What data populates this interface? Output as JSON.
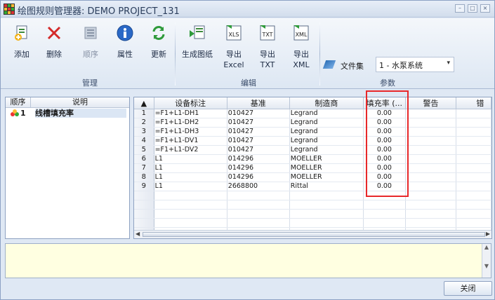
{
  "window": {
    "title": "绘图规则管理器: DEMO PROJECT_131"
  },
  "ribbon": {
    "manage": {
      "label": "管理",
      "add": "添加",
      "delete": "删除",
      "order": "顺序",
      "properties": "属性",
      "update": "更新"
    },
    "edit": {
      "label": "编辑",
      "generate": "生成图纸",
      "export_excel_1": "导出",
      "export_excel_2": "Excel",
      "export_txt_1": "导出",
      "export_txt_2": "TXT",
      "export_xml_1": "导出",
      "export_xml_2": "XML",
      "xls_tag": "XLS",
      "txt_tag": "TXT",
      "xml_tag": "XML"
    },
    "params": {
      "label": "参数",
      "fileset_label": "文件集",
      "fileset_value": "1 - 水泵系统"
    }
  },
  "left_panel": {
    "headers": {
      "order": "顺序",
      "description": "说明"
    },
    "row": {
      "number": "1",
      "description": "线槽填充率"
    }
  },
  "grid": {
    "headers": {
      "device": "设备标注",
      "basis": "基准",
      "manufacturer": "制造商",
      "fill_rate": "填充率 (...",
      "warning": "警告",
      "error": "错"
    },
    "rows": [
      {
        "n": "1",
        "device": "=F1+L1-DH1",
        "basis": "010427",
        "manufacturer": "Legrand",
        "fill": "0.00"
      },
      {
        "n": "2",
        "device": "=F1+L1-DH2",
        "basis": "010427",
        "manufacturer": "Legrand",
        "fill": "0.00"
      },
      {
        "n": "3",
        "device": "=F1+L1-DH3",
        "basis": "010427",
        "manufacturer": "Legrand",
        "fill": "0.00"
      },
      {
        "n": "4",
        "device": "=F1+L1-DV1",
        "basis": "010427",
        "manufacturer": "Legrand",
        "fill": "0.00"
      },
      {
        "n": "5",
        "device": "=F1+L1-DV2",
        "basis": "010427",
        "manufacturer": "Legrand",
        "fill": "0.00"
      },
      {
        "n": "6",
        "device": "L1",
        "basis": "014296",
        "manufacturer": "MOELLER",
        "fill": "0.00"
      },
      {
        "n": "7",
        "device": "L1",
        "basis": "014296",
        "manufacturer": "MOELLER",
        "fill": "0.00"
      },
      {
        "n": "8",
        "device": "L1",
        "basis": "014296",
        "manufacturer": "MOELLER",
        "fill": "0.00"
      },
      {
        "n": "9",
        "device": "L1",
        "basis": "2668800",
        "manufacturer": "Rittal",
        "fill": "0.00"
      }
    ]
  },
  "footer": {
    "close": "关闭"
  },
  "colors": {
    "highlight": "#e8282a",
    "notes_bg": "#ffffe1",
    "selection": "#dbe6f4"
  }
}
